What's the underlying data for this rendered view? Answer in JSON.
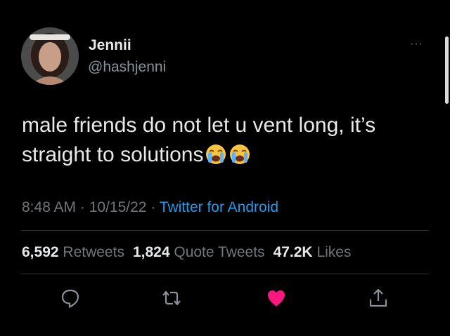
{
  "user": {
    "display_name": "Jennii",
    "handle": "@hashjenni"
  },
  "more_label": "···",
  "tweet": {
    "text": "male friends do not let u vent long, it’s straight to solutions",
    "emojis": [
      "loudly-crying-face-emoji",
      "loudly-crying-face-emoji"
    ]
  },
  "meta": {
    "time": "8:48 AM",
    "sep1": " · ",
    "date": "10/15/22",
    "sep2": " · ",
    "source": "Twitter for Android"
  },
  "stats": {
    "retweets_count": "6,592",
    "retweets_label": "Retweets",
    "quotes_count": "1,824",
    "quotes_label": "Quote Tweets",
    "likes_count": "47.2K",
    "likes_label": "Likes"
  },
  "actions": {
    "reply_icon": "reply-icon",
    "retweet_icon": "retweet-icon",
    "like_icon": "heart-icon",
    "share_icon": "share-icon"
  },
  "colors": {
    "background": "#000000",
    "text": "#e7e9ea",
    "muted": "#71767b",
    "accent": "#1d9bf0",
    "like": "#f91880"
  }
}
